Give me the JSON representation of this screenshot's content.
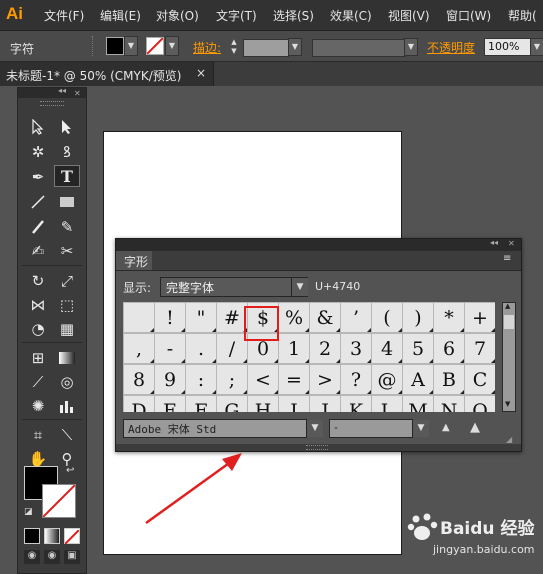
{
  "app": {
    "logo": "Ai"
  },
  "menu": [
    "文件(F)",
    "编辑(E)",
    "对象(O)",
    "文字(T)",
    "选择(S)",
    "效果(C)",
    "视图(V)",
    "窗口(W)",
    "帮助("
  ],
  "control_bar": {
    "label": "字符",
    "stroke_label": "描边:",
    "opacity_label": "不透明度",
    "opacity_value": "100%"
  },
  "document_tab": {
    "title": "未标题-1* @ 50% (CMYK/预览)",
    "close": "×"
  },
  "glyph_panel": {
    "title": "字形",
    "show_label": "显示:",
    "show_value": "完整字体",
    "unicode": "U+4740",
    "rows": [
      [
        "",
        "!",
        "\"",
        "#",
        "$",
        "%",
        "&",
        "’",
        "(",
        ")",
        "*",
        "+"
      ],
      [
        ",",
        "-",
        ".",
        "/",
        "0",
        "1",
        "2",
        "3",
        "4",
        "5",
        "6",
        "7"
      ],
      [
        "8",
        "9",
        ":",
        ";",
        "<",
        "=",
        ">",
        "?",
        "@",
        "A",
        "B",
        "C"
      ],
      [
        "D",
        "E",
        "F",
        "G",
        "H",
        "I",
        "J",
        "K",
        "L",
        "M",
        "N",
        "O"
      ]
    ],
    "highlighted_glyph": "$",
    "font_family": "Adobe 宋体 Std",
    "font_style": "-"
  },
  "watermark": {
    "main": "Baidu 经验",
    "sub": "jingyan.baidu.com"
  },
  "colors": {
    "accent_orange": "#ff9a00",
    "highlight_red": "#e21b1b",
    "canvas_bg": "#535353"
  }
}
